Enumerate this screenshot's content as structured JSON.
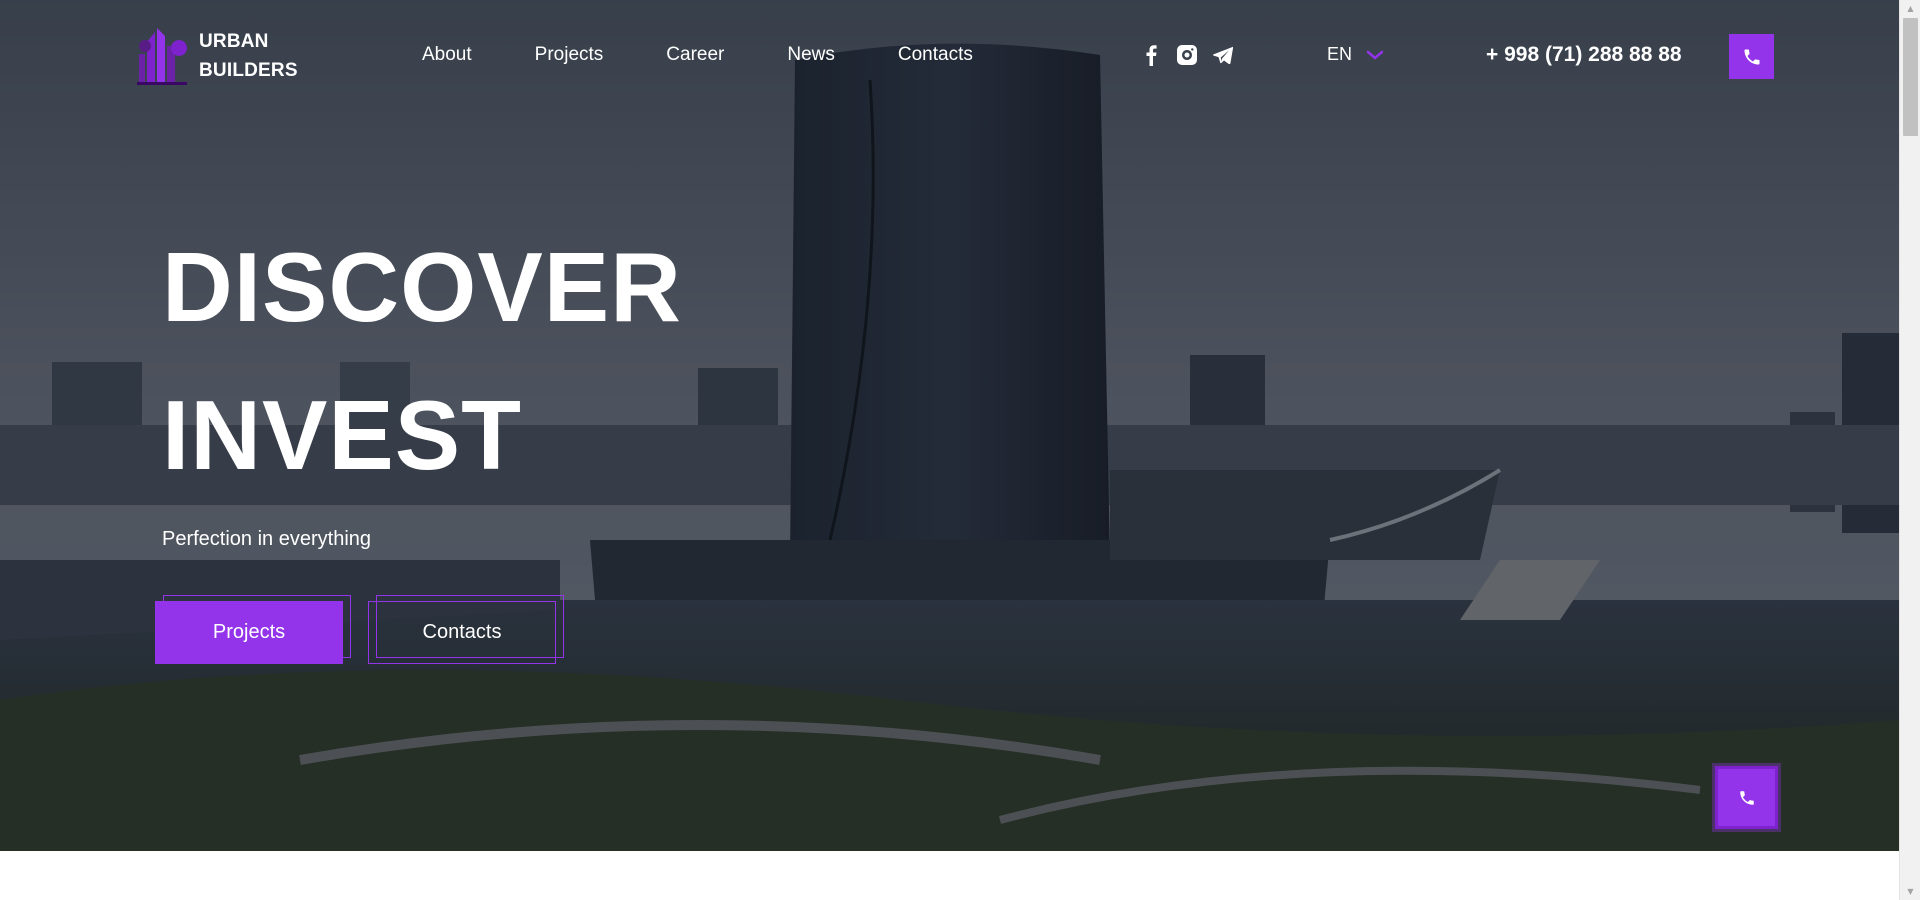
{
  "brand": {
    "line1": "URBAN",
    "line2": "BUILDERS",
    "logo_icon": "building-logo-icon",
    "accent_color": "#9333ea"
  },
  "nav": {
    "items": [
      {
        "label": "About"
      },
      {
        "label": "Projects"
      },
      {
        "label": "Career"
      },
      {
        "label": "News"
      },
      {
        "label": "Contacts"
      }
    ]
  },
  "socials": [
    {
      "icon": "facebook-icon"
    },
    {
      "icon": "instagram-icon"
    },
    {
      "icon": "telegram-icon"
    }
  ],
  "language": {
    "selected": "EN",
    "icon": "chevron-down-icon"
  },
  "phone": {
    "number": "+ 998 (71) 288 88 88",
    "icon": "phone-icon"
  },
  "hero": {
    "title_line1": "DISCOVER",
    "title_line2": "INVEST",
    "subtitle": "Perfection in everything",
    "primary_button": "Projects",
    "secondary_button": "Contacts"
  },
  "floating_call": {
    "icon": "phone-icon"
  }
}
